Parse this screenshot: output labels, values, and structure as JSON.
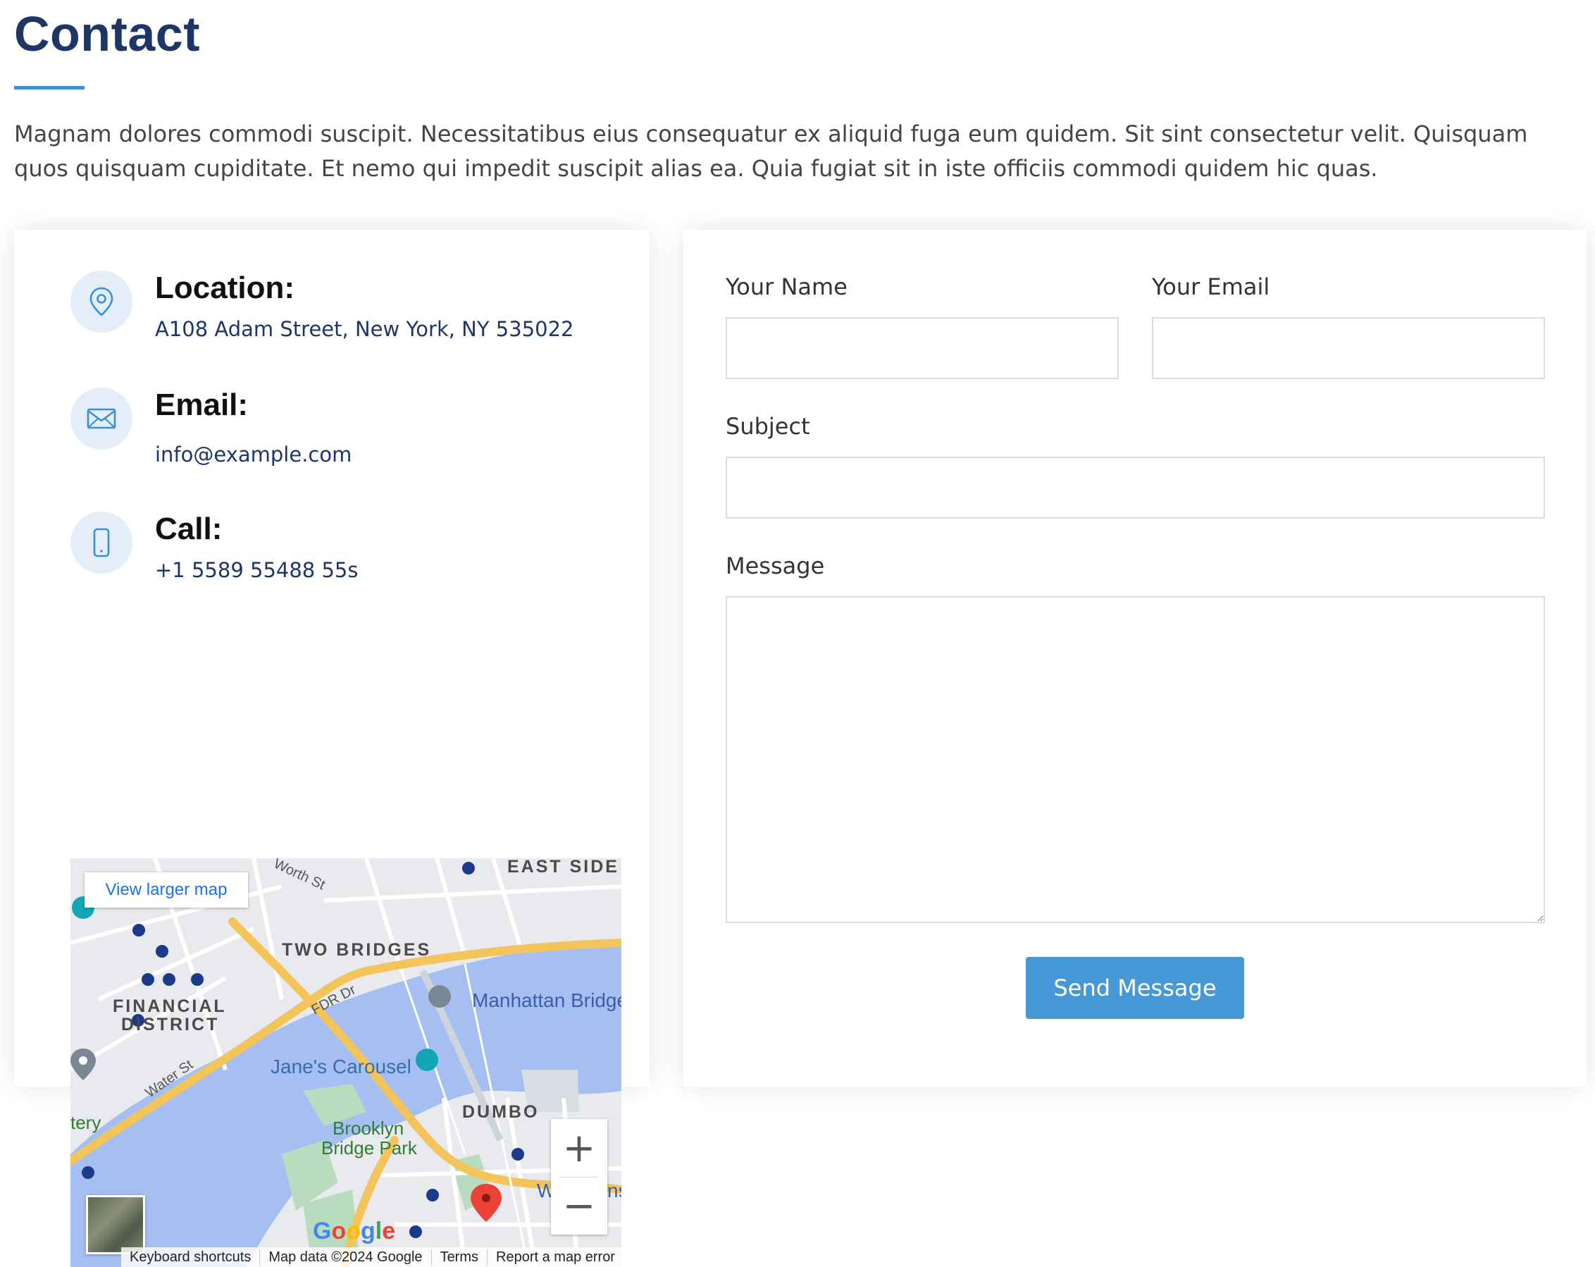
{
  "section": {
    "title": "Contact",
    "intro": "Magnam dolores commodi suscipit. Necessitatibus eius consequatur ex aliquid fuga eum quidem. Sit sint consectetur velit. Quisquam quos quisquam cupiditate. Et nemo qui impedit suscipit alias ea. Quia fugiat sit in iste officiis commodi quidem hic quas."
  },
  "info": {
    "location": {
      "title": "Location:",
      "text": "A108 Adam Street, New York, NY 535022",
      "icon": "map-pin-icon"
    },
    "email": {
      "title": "Email:",
      "text": "info@example.com",
      "icon": "envelope-icon"
    },
    "call": {
      "title": "Call:",
      "text": "+1 5589 55488 55s",
      "icon": "phone-icon"
    }
  },
  "map": {
    "view_larger": "View larger map",
    "labels": {
      "east_side": "EAST SIDE",
      "two_bridges": "TWO BRIDGES",
      "financial_district_1": "FINANCIAL",
      "financial_district_2": "DISTRICT",
      "manhattan_bridge": "Manhattan Bridge",
      "janes_carousel": "Jane's Carousel",
      "dumbo": "DUMBO",
      "brooklyn_bridge_park_1": "Brooklyn",
      "brooklyn_bridge_park_2": "Bridge Park",
      "fdr_dr": "FDR Dr",
      "water_st": "Water St",
      "worth_st": "Worth St",
      "battery_partial": "tery",
      "w_partial": "W",
      "ns_partial": "ns"
    },
    "zoom_in": "+",
    "zoom_out": "−",
    "google": "Google",
    "footer": {
      "shortcuts": "Keyboard shortcuts",
      "map_data": "Map data ©2024 Google",
      "terms": "Terms",
      "report": "Report a map error"
    },
    "colors": {
      "water": "#a5bff2",
      "land": "#e9eaee",
      "highway": "#f7cd6a",
      "park": "#a8dab5"
    }
  },
  "form": {
    "name_label": "Your Name",
    "email_label": "Your Email",
    "subject_label": "Subject",
    "message_label": "Message",
    "name_value": "",
    "email_value": "",
    "subject_value": "",
    "message_value": "",
    "send_label": "Send Message"
  },
  "colors": {
    "accent": "#4699d6",
    "heading": "#1e3666",
    "icon_bg": "#e3eef9"
  }
}
